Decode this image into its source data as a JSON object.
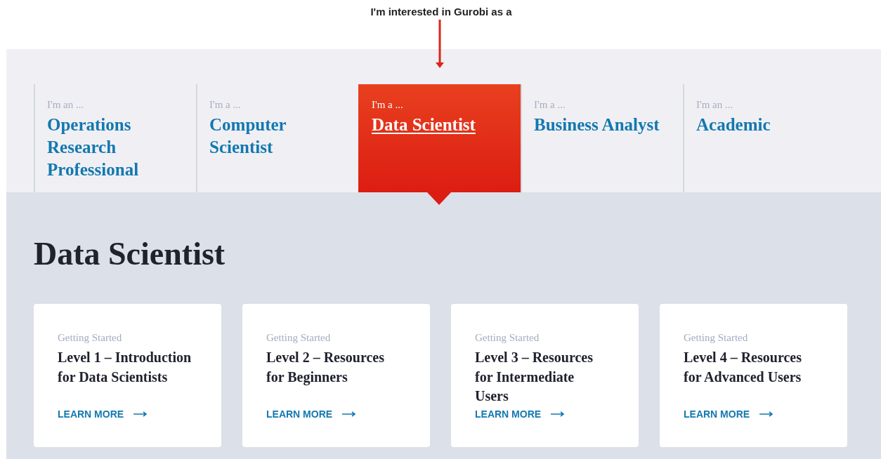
{
  "annotation": {
    "text": "I'm interested in Gurobi as a"
  },
  "tabs": [
    {
      "prefix": "I'm an ...",
      "label": "Operations Research Professional",
      "selected": false
    },
    {
      "prefix": "I'm a ...",
      "label": "Computer Scientist",
      "selected": false
    },
    {
      "prefix": "I'm a ...",
      "label": "Data Scientist",
      "selected": true
    },
    {
      "prefix": "I'm a ...",
      "label": "Business Analyst",
      "selected": false
    },
    {
      "prefix": "I'm an ...",
      "label": "Academic",
      "selected": false
    }
  ],
  "heading": "Data Scientist",
  "cards": [
    {
      "category": "Getting Started",
      "title": "Level 1 – Introduction for Data Scientists",
      "link": "LEARN MORE"
    },
    {
      "category": "Getting Started",
      "title": "Level 2 – Resources for Beginners",
      "link": "LEARN MORE"
    },
    {
      "category": "Getting Started",
      "title": "Level 3 – Resources for Intermediate Users",
      "link": "LEARN MORE"
    },
    {
      "category": "Getting Started",
      "title": "Level 4 – Resources for Advanced Users",
      "link": "LEARN MORE"
    }
  ]
}
